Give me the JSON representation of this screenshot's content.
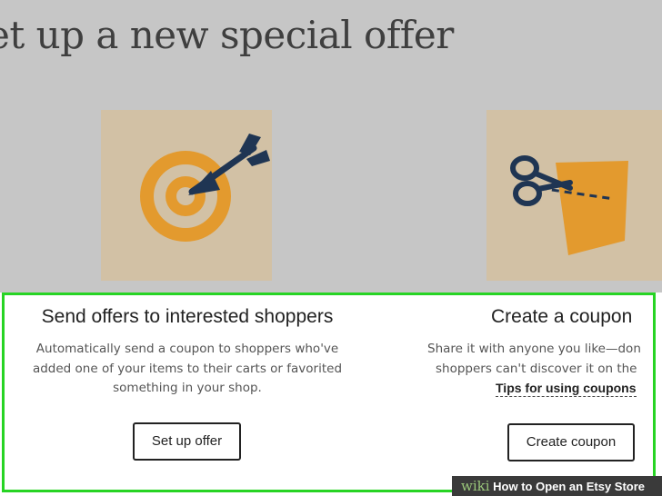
{
  "page": {
    "heading": "et up a new special offer"
  },
  "cards": {
    "left": {
      "icon": "target-icon",
      "title": "Send offers to interested shoppers",
      "description_lines": [
        "Automatically send a coupon to shoppers who've",
        "added one of your items to their carts or favorited",
        "something in your shop."
      ],
      "button_label": "Set up offer"
    },
    "right": {
      "icon": "scissors-coupon-icon",
      "title": "Create a coupon",
      "description_lines": [
        "Share it with anyone you like—don",
        "shoppers can't discover it on the"
      ],
      "link_label": "Tips for using coupons",
      "button_label": "Create coupon"
    }
  },
  "colors": {
    "overlay": "#c6c6c6",
    "tile_background": "#d2c1a5",
    "accent_orange": "#e39a2e",
    "icon_navy": "#1f3553",
    "highlight_border": "#27d424"
  },
  "watermark": {
    "prefix": "wiki",
    "text": "How to Open an Etsy Store"
  }
}
